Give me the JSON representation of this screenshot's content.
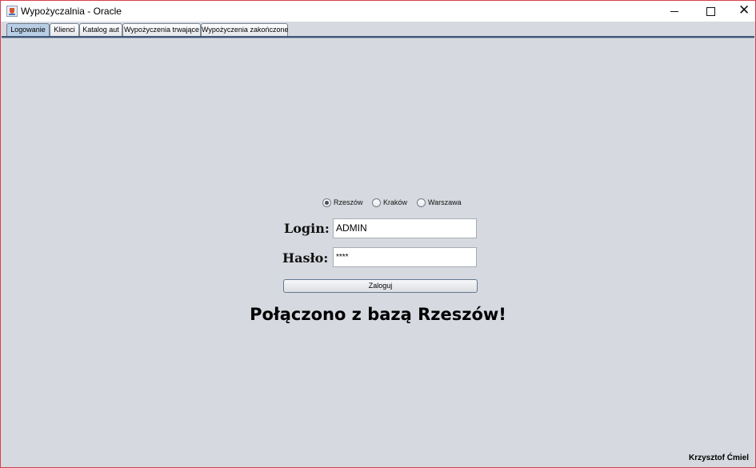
{
  "window": {
    "title": "Wypożyczalnia - Oracle",
    "controls": {
      "minimize": "—",
      "maximize": "□",
      "close": "✕"
    }
  },
  "tabs": [
    {
      "label": "Logowanie",
      "active": true
    },
    {
      "label": "Klienci",
      "active": false
    },
    {
      "label": "Katalog aut",
      "active": false
    },
    {
      "label": "Wypożyczenia trwające",
      "active": false
    },
    {
      "label": "Wypożyczenia zakończone",
      "active": false
    }
  ],
  "branches": {
    "options": [
      "Rzeszów",
      "Kraków",
      "Warszawa"
    ],
    "selected": "Rzeszów"
  },
  "form": {
    "login_label": "Login:",
    "login_value": "ADMIN",
    "password_label": "Hasło:",
    "password_value": "****",
    "submit_label": "Zaloguj"
  },
  "status_message": "Połączono z bazą Rzeszów!",
  "author": "Krzysztof Ćmiel",
  "colors": {
    "window_border": "#d8404f",
    "panel_background": "#d6d9df",
    "active_tab": "#b8cfe5"
  },
  "icons": {
    "app": "java-app-icon"
  }
}
